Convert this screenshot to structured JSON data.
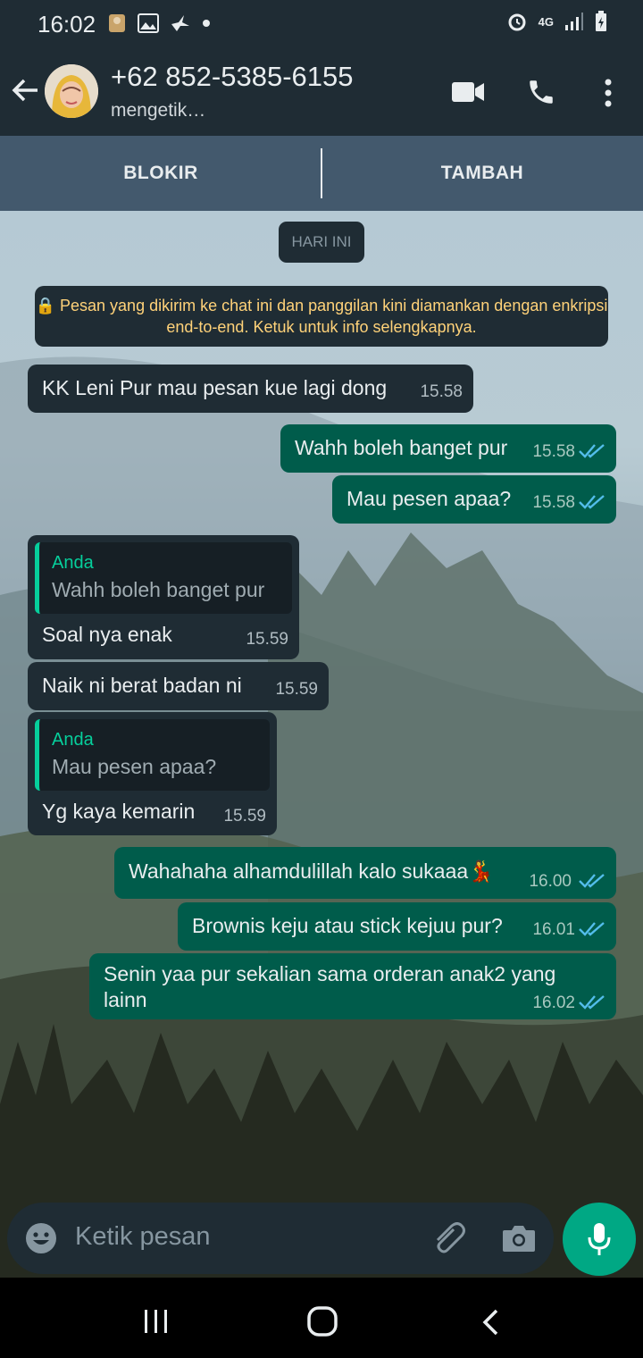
{
  "status_bar": {
    "time": "16:02",
    "network": "4G",
    "icons": [
      "photo-icon",
      "image-icon",
      "bird-icon",
      "dot-icon",
      "alarm-icon",
      "signal-icon",
      "battery-icon"
    ]
  },
  "header": {
    "contact_name": "+62 852-5385-6155",
    "contact_status": "mengetik…"
  },
  "actions": {
    "block_label": "BLOKIR",
    "add_label": "TAMBAH"
  },
  "chat": {
    "date_label": "HARI INI",
    "encryption_notice": "🔒 Pesan yang dikirim ke chat ini dan panggilan kini diamankan dengan enkripsi end-to-end. Ketuk untuk info selengkapnya.",
    "messages": [
      {
        "direction": "in",
        "text": "KK Leni Pur mau pesan kue lagi dong",
        "time": "15.58"
      },
      {
        "direction": "out",
        "text": "Wahh boleh banget pur",
        "time": "15.58",
        "status": "read"
      },
      {
        "direction": "out",
        "text": "Mau pesen apaa?",
        "time": "15.58",
        "status": "read"
      },
      {
        "direction": "in",
        "quote_author": "Anda",
        "quote_text": "Wahh boleh banget pur",
        "text": "Soal nya enak",
        "time": "15.59"
      },
      {
        "direction": "in",
        "text": "Naik ni berat badan ni",
        "time": "15.59"
      },
      {
        "direction": "in",
        "quote_author": "Anda",
        "quote_text": "Mau pesen apaa?",
        "text": "Yg kaya kemarin",
        "time": "15.59"
      },
      {
        "direction": "out",
        "text": "Wahahaha alhamdulillah kalo sukaaa💃",
        "time": "16.00",
        "status": "read"
      },
      {
        "direction": "out",
        "text": "Brownis keju atau stick kejuu pur?",
        "time": "16.01",
        "status": "read"
      },
      {
        "direction": "out",
        "text": "Senin yaa pur sekalian sama orderan anak2 yang lainn",
        "time": "16.02",
        "status": "read"
      }
    ]
  },
  "composer": {
    "placeholder": "Ketik pesan"
  },
  "colors": {
    "header_bg": "#1f2c34",
    "incoming_bubble": "#1f2c34",
    "outgoing_bubble": "#005c4b",
    "accent": "#00a884",
    "read_ticks": "#53bdeb",
    "quote_bar": "#06cf9c"
  }
}
